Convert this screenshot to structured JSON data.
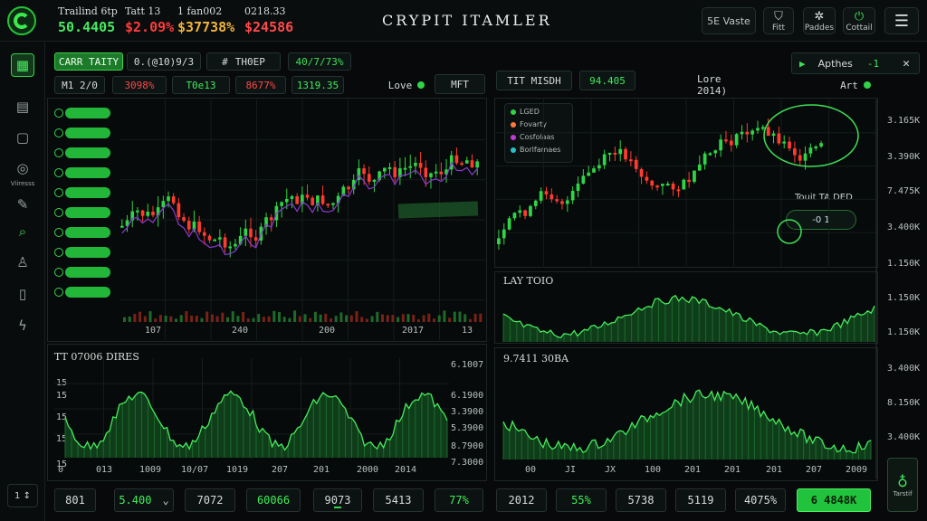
{
  "app_title": "CRYPIT ITAMLER",
  "tickers": [
    {
      "label": "Trailind 6tp",
      "value": "50.4405",
      "color": "#49e860"
    },
    {
      "label": "Tatt 13",
      "value": "$2.09%",
      "color": "#ff3b3b"
    },
    {
      "label": "1 fan002",
      "value": "$37738%",
      "color": "#f0b43a"
    },
    {
      "label": "0218.33",
      "value": "$24586",
      "color": "#ff4a4a"
    }
  ],
  "top_buttons": [
    {
      "label": "5E Vaste",
      "icon": "grid-icon"
    },
    {
      "label": "Fitt",
      "icon": "shield-icon"
    },
    {
      "label": "Paddes",
      "icon": "gear-icon"
    },
    {
      "label": "Cottail",
      "icon": "power-icon"
    }
  ],
  "menu_icon": "hamburger-icon",
  "rail": [
    {
      "name": "dashboard-icon",
      "glyph": "▦",
      "label": ""
    },
    {
      "name": "chart-icon",
      "glyph": "▤",
      "label": ""
    },
    {
      "name": "wallet-icon",
      "glyph": "▢",
      "label": ""
    },
    {
      "name": "globe-icon",
      "glyph": "◎",
      "label": "Viiresss"
    },
    {
      "name": "pen-icon",
      "glyph": "✎",
      "label": ""
    },
    {
      "name": "search-icon",
      "glyph": "⌕",
      "label": ""
    },
    {
      "name": "user-icon",
      "glyph": "♙",
      "label": ""
    },
    {
      "name": "device-icon",
      "glyph": "▯",
      "label": ""
    },
    {
      "name": "bolt-icon",
      "glyph": "ϟ",
      "label": ""
    }
  ],
  "rail_bottom": "1 ↕",
  "left_toolbar": {
    "tab_active": "CARR TAITY",
    "tab2": "0.(@10)9/3",
    "tab3": "TH0EP",
    "tab4": "40/7/73%",
    "row2": [
      "M1 2/0",
      "3098%",
      "T0e13",
      "8677%",
      "1319.35"
    ],
    "row2_colors": [
      "#d5dcda",
      "#ff4747",
      "#42e85a",
      "#ff4747",
      "#42e85a"
    ],
    "love_label": "Love",
    "mft_label": "MFT"
  },
  "right_toolbar": {
    "tab1": "TIT MISDH",
    "tab2": "94.405",
    "date": "Lore 2014)",
    "apt": "Art",
    "notice": "Apthes",
    "notice_num": "-1"
  },
  "candle_axis": [
    "107",
    "240",
    "200",
    "2017",
    "13"
  ],
  "right_axis": [
    "3.165K",
    "3.390K",
    "7.475K",
    "3.400K",
    "1.150K",
    "1.150K",
    "1.150K",
    "3.400K",
    "8.150K",
    "3.400K"
  ],
  "legend": [
    {
      "label": "LGED",
      "color": "#2fd447"
    },
    {
      "label": "Fovarty",
      "color": "#ff7a3a"
    },
    {
      "label": "Cosfolaas",
      "color": "#c23ad8"
    },
    {
      "label": "Borlfamaes",
      "color": "#27c2c8"
    }
  ],
  "tooltip": {
    "title": "Touit TA DED",
    "value": "-0 1"
  },
  "lower_left": {
    "title": "TT 07006 DIRES",
    "y_left": [
      "15",
      "15",
      "15",
      "15",
      "15"
    ],
    "y_right": [
      "6.1007",
      "6.1900",
      "3.3900",
      "5.3900",
      "8.7900",
      "7.3000"
    ],
    "x": [
      "0",
      "013",
      "1009",
      "10/07",
      "1019",
      "207",
      "201",
      "2000",
      "2014"
    ]
  },
  "mid_right": {
    "title": "LAY TOIO"
  },
  "lower_right": {
    "title": "9.7411 30BA",
    "x": [
      "00",
      "JI",
      "JX",
      "100",
      "201",
      "201",
      "201",
      "207",
      "2009"
    ]
  },
  "footer": [
    {
      "label": "801",
      "style": ""
    },
    {
      "label": "5.400",
      "style": "g",
      "dropdown": "⌄"
    },
    {
      "label": "7072",
      "style": ""
    },
    {
      "label": "60066",
      "style": "g"
    },
    {
      "label": "9073",
      "style": "ul"
    },
    {
      "label": "5413",
      "style": ""
    },
    {
      "label": "77%",
      "style": "g"
    },
    {
      "label": "2012",
      "style": ""
    },
    {
      "label": "55%",
      "style": "g"
    },
    {
      "label": "5738",
      "style": ""
    },
    {
      "label": "5119",
      "style": ""
    },
    {
      "label": "4075%",
      "style": ""
    },
    {
      "label": "6 4848K",
      "style": "cta"
    }
  ],
  "wallet_label": "Tarstif",
  "colors": {
    "up": "#2fd447",
    "down": "#ff3b2f",
    "accent": "#2fd447",
    "ma": "#8a3ad0"
  }
}
